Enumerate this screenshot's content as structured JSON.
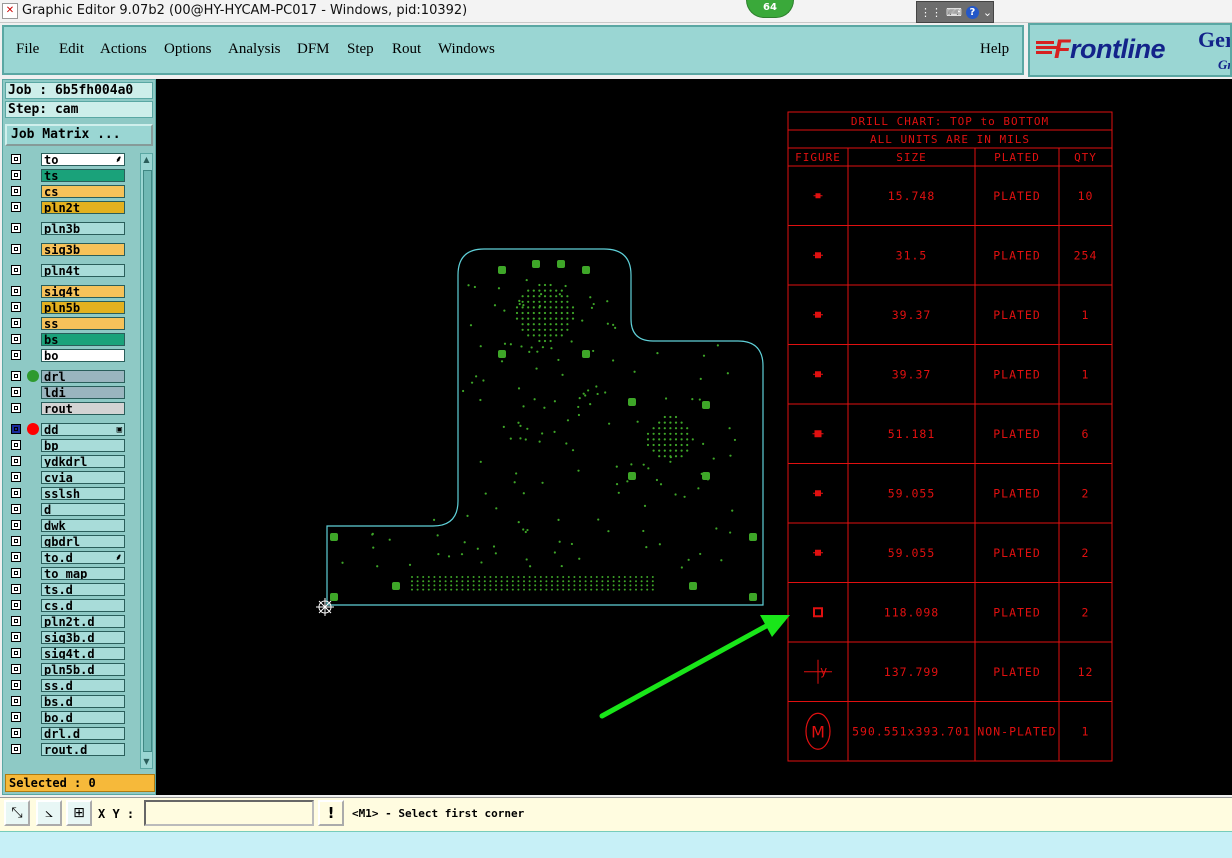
{
  "window": {
    "title": "Graphic Editor 9.07b2 (00@HY-HYCAM-PC017 - Windows, pid:10392)",
    "badge": "64",
    "tray_help": "?"
  },
  "menu": {
    "items": [
      "File",
      "Edit",
      "Actions",
      "Options",
      "Analysis",
      "DFM",
      "Step",
      "Rout",
      "Windows"
    ],
    "help": "Help"
  },
  "logo": {
    "prefix": "F",
    "brand": "rontline",
    "suffix": "Ger",
    "sub": "Gr"
  },
  "panel": {
    "job": "Job : 6b5fh004a0",
    "step": "Step: cam",
    "job_matrix": "Job Matrix ...",
    "selected": "Selected : 0",
    "layers": [
      {
        "name": "to",
        "color": "#ffffff",
        "mark": "⸙"
      },
      {
        "name": "ts",
        "color": "#1aa27a"
      },
      {
        "name": "cs",
        "color": "#f6c25a"
      },
      {
        "name": "pln2t",
        "color": "#e3b11f"
      },
      {
        "name": "pln3b",
        "color": "#a8dcd9"
      },
      {
        "name": "sig3b",
        "color": "#f6c25a"
      },
      {
        "name": "pln4t",
        "color": "#a8dcd9"
      },
      {
        "name": "sig4t",
        "color": "#f6c25a"
      },
      {
        "name": "pln5b",
        "color": "#e3b11f"
      },
      {
        "name": "ss",
        "color": "#f6c25a"
      },
      {
        "name": "bs",
        "color": "#1aa27a"
      },
      {
        "name": "bo",
        "color": "#ffffff"
      },
      {
        "name": "drl",
        "color": "#9ab5bf",
        "dot": "#2e9a2e"
      },
      {
        "name": "ldi",
        "color": "#9ab5bf"
      },
      {
        "name": "rout",
        "color": "#d3d3d3"
      },
      {
        "name": "dd",
        "color": "#a8dcd9",
        "dot": "#ff0000",
        "active": true,
        "mark": "▣"
      },
      {
        "name": "bp",
        "color": "#a8dcd9"
      },
      {
        "name": "ydkdrl",
        "color": "#a8dcd9"
      },
      {
        "name": "cvia",
        "color": "#a8dcd9"
      },
      {
        "name": "sslsh",
        "color": "#a8dcd9"
      },
      {
        "name": "d",
        "color": "#a8dcd9"
      },
      {
        "name": "dwk",
        "color": "#a8dcd9"
      },
      {
        "name": "gbdrl",
        "color": "#a8dcd9"
      },
      {
        "name": "to.d",
        "color": "#a8dcd9",
        "mark": "⸙"
      },
      {
        "name": "to_map",
        "color": "#a8dcd9"
      },
      {
        "name": "ts.d",
        "color": "#a8dcd9"
      },
      {
        "name": "cs.d",
        "color": "#a8dcd9"
      },
      {
        "name": "pln2t.d",
        "color": "#a8dcd9"
      },
      {
        "name": "sig3b.d",
        "color": "#a8dcd9"
      },
      {
        "name": "sig4t.d",
        "color": "#a8dcd9"
      },
      {
        "name": "pln5b.d",
        "color": "#a8dcd9"
      },
      {
        "name": "ss.d",
        "color": "#a8dcd9"
      },
      {
        "name": "bs.d",
        "color": "#a8dcd9"
      },
      {
        "name": "bo.d",
        "color": "#a8dcd9"
      },
      {
        "name": "drl.d",
        "color": "#a8dcd9"
      },
      {
        "name": "rout.d",
        "color": "#a8dcd9"
      }
    ]
  },
  "drill_chart": {
    "title": "DRILL CHART: TOP to BOTTOM",
    "units": "ALL UNITS ARE IN MILS",
    "headers": [
      "FIGURE",
      "SIZE",
      "PLATED",
      "QTY"
    ],
    "rows": [
      {
        "size": "15.748",
        "plated": "PLATED",
        "qty": "10"
      },
      {
        "size": "31.5",
        "plated": "PLATED",
        "qty": "254"
      },
      {
        "size": "39.37",
        "plated": "PLATED",
        "qty": "1"
      },
      {
        "size": "39.37",
        "plated": "PLATED",
        "qty": "1"
      },
      {
        "size": "51.181",
        "plated": "PLATED",
        "qty": "6"
      },
      {
        "size": "59.055",
        "plated": "PLATED",
        "qty": "2"
      },
      {
        "size": "59.055",
        "plated": "PLATED",
        "qty": "2"
      },
      {
        "size": "118.098",
        "plated": "PLATED",
        "qty": "2"
      },
      {
        "size": "137.799",
        "plated": "PLATED",
        "qty": "12"
      },
      {
        "size": "590.551x393.701",
        "plated": "NON-PLATED",
        "qty": "1"
      }
    ],
    "fig_last": "M",
    "fig_y": "y"
  },
  "colors": {
    "chart": "#e01010",
    "board_outline": "#5fd0d8",
    "pads": "#3ea628",
    "arrow": "#19e619"
  },
  "status": {
    "xy_label": "X Y :",
    "xy_value": "",
    "warn": "!",
    "prompt": "<M1> - Select first corner"
  }
}
